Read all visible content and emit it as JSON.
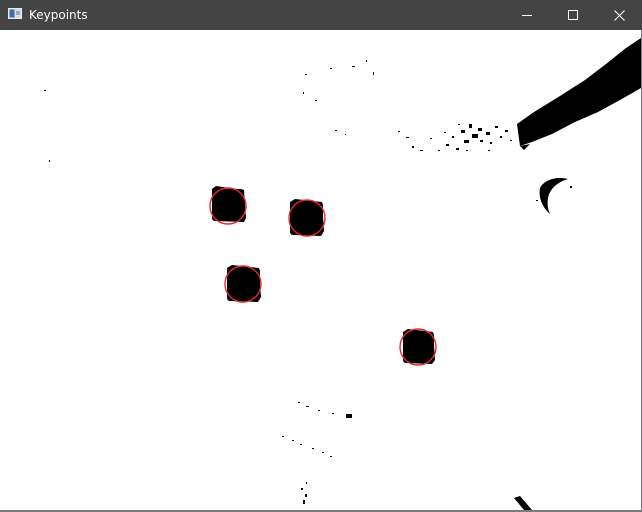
{
  "window": {
    "title": "Keypoints",
    "icon": "opencv-window-icon",
    "controls": {
      "minimize_icon": "minimize-icon",
      "maximize_icon": "maximize-icon",
      "close_icon": "close-icon"
    }
  },
  "image": {
    "background_color": "#ffffff",
    "foreground_color": "#000000",
    "keypoint_color": "#e8272b"
  }
}
